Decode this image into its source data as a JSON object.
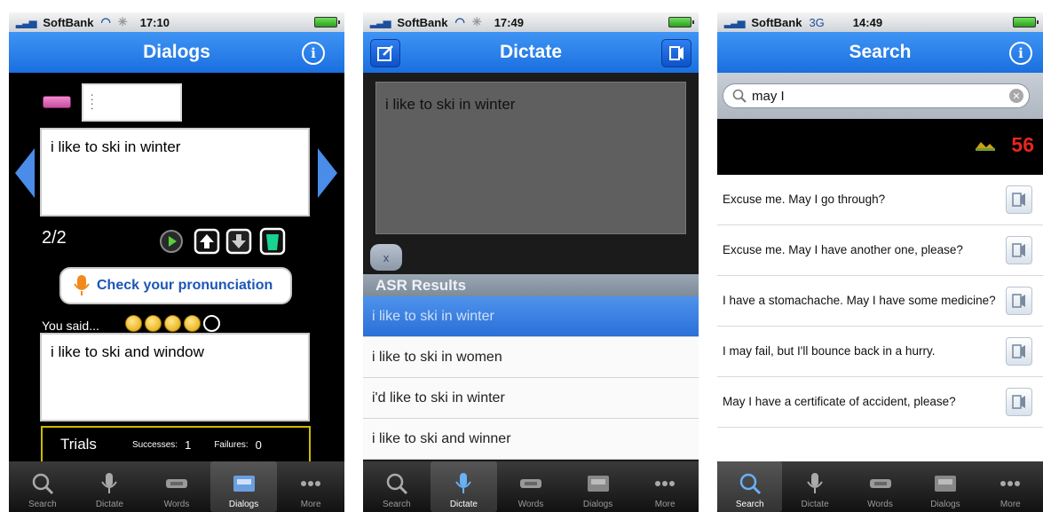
{
  "status_bars": [
    {
      "carrier": "SoftBank",
      "network": "",
      "time": "17:10"
    },
    {
      "carrier": "SoftBank",
      "network": "",
      "time": "17:49"
    },
    {
      "carrier": "SoftBank",
      "network": "3G",
      "time": "14:49"
    }
  ],
  "tabs": [
    "Search",
    "Dictate",
    "Words",
    "Dialogs",
    "More"
  ],
  "dialogs": {
    "title": "Dialogs",
    "prompt_text": "i like to ski in winter",
    "counter": "2/2",
    "pronunciation_button": "Check your pronunciation",
    "you_said_label": "You said...",
    "score_coins_filled": 4,
    "score_coins_total": 5,
    "recognized_text": "i like to ski and window",
    "trials_label": "Trials",
    "successes_label": "Successes:",
    "successes_value": "1",
    "failures_label": "Failures:",
    "failures_value": "0",
    "active_tab": 3
  },
  "dictate": {
    "title": "Dictate",
    "dictation_text": "i like to ski in winter",
    "clear_button": "x",
    "asr_header": "ASR Results",
    "asr_results": [
      "i like to ski in winter",
      "i like to ski in women",
      "i'd like to ski in winter",
      "i like to ski and winner"
    ],
    "selected_index": 0,
    "active_tab": 1
  },
  "search": {
    "title": "Search",
    "query": "may I",
    "score": "56",
    "results": [
      "Excuse me. May I go through?",
      "Excuse me. May I have another one, please?",
      "I have a stomachache. May I have some medicine?",
      "I may fail, but I'll bounce back in a hurry.",
      "May I have a certificate of accident, please?"
    ],
    "active_tab": 0
  },
  "colors": {
    "nav_blue": "#1a6fe0",
    "score_red": "#e8261c",
    "trials_border": "#cdbb00"
  }
}
